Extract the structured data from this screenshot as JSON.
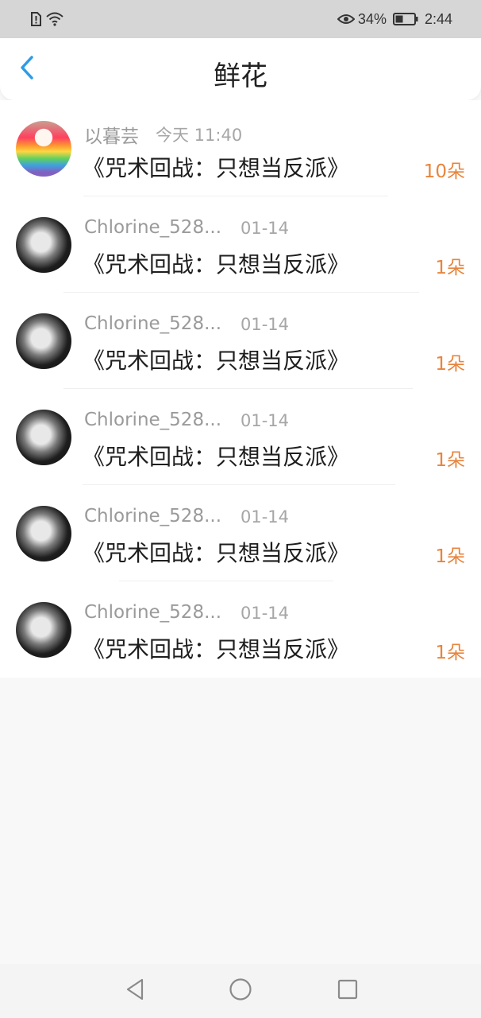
{
  "status_bar": {
    "battery": "34%",
    "time": "2:44"
  },
  "header": {
    "title": "鲜花"
  },
  "colors": {
    "accent_blue": "#2d9be8",
    "count_orange": "#e8843c"
  },
  "items": [
    {
      "name": "以暮芸",
      "date": "今天 11:40",
      "book": "《咒术回战：只想当反派》",
      "count": "10朵",
      "avatar": "rainbow-drink-avatar"
    },
    {
      "name": "Chlorine_528...",
      "date": "01-14",
      "book": "《咒术回战：只想当反派》",
      "count": "1朵",
      "avatar": "anime-character-avatar"
    },
    {
      "name": "Chlorine_528...",
      "date": "01-14",
      "book": "《咒术回战：只想当反派》",
      "count": "1朵",
      "avatar": "anime-character-avatar"
    },
    {
      "name": "Chlorine_528...",
      "date": "01-14",
      "book": "《咒术回战：只想当反派》",
      "count": "1朵",
      "avatar": "anime-character-avatar"
    },
    {
      "name": "Chlorine_528...",
      "date": "01-14",
      "book": "《咒术回战：只想当反派》",
      "count": "1朵",
      "avatar": "anime-character-avatar"
    },
    {
      "name": "Chlorine_528...",
      "date": "01-14",
      "book": "《咒术回战：只想当反派》",
      "count": "1朵",
      "avatar": "anime-character-avatar"
    }
  ]
}
